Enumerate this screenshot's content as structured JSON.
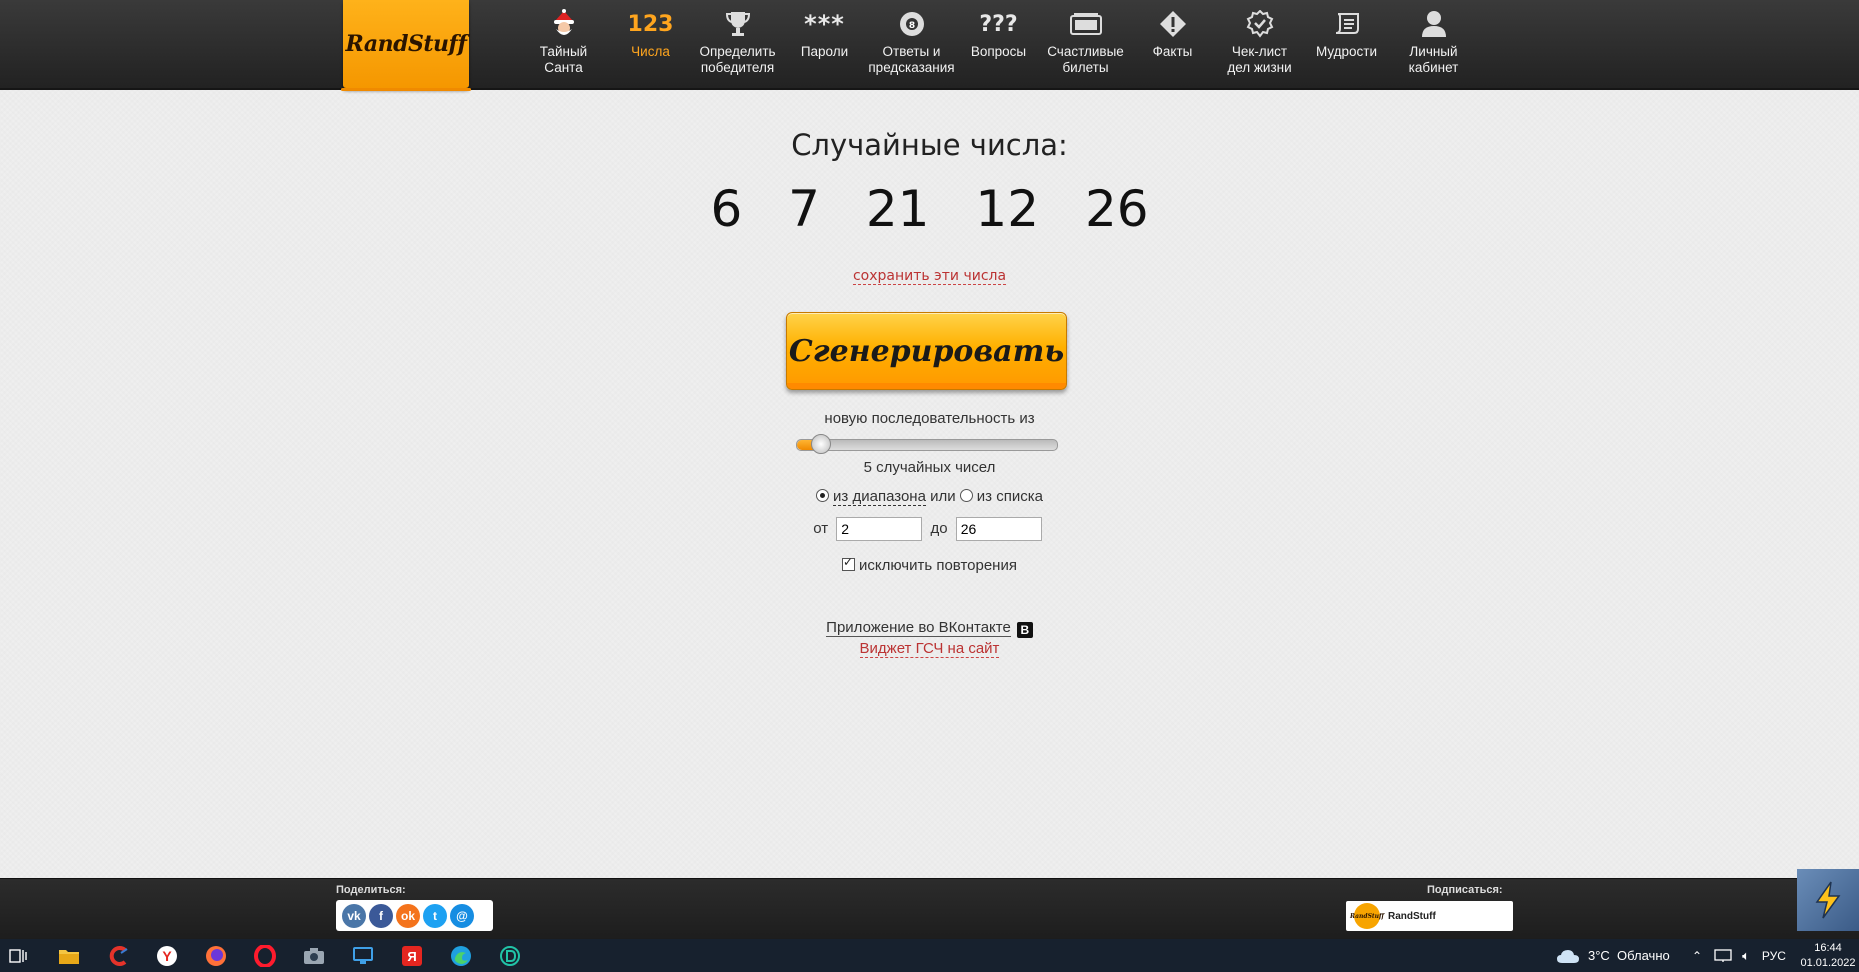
{
  "logo": {
    "text": "RandStuff"
  },
  "nav": {
    "items": [
      {
        "label": "Тайный\nСанта",
        "icon": "santa-icon"
      },
      {
        "label": "Числа",
        "icon": "numbers-icon",
        "icon_text": "123",
        "active": true
      },
      {
        "label": "Определить\nпобедителя",
        "icon": "trophy-icon"
      },
      {
        "label": "Пароли",
        "icon": "password-icon",
        "icon_text": "***"
      },
      {
        "label": "Ответы и\nпредсказания",
        "icon": "eight-ball-icon"
      },
      {
        "label": "Вопросы",
        "icon": "question-icon",
        "icon_text": "???"
      },
      {
        "label": "Счастливые\nбилеты",
        "icon": "ticket-icon"
      },
      {
        "label": "Факты",
        "icon": "fact-icon"
      },
      {
        "label": "Чек-лист\nдел жизни",
        "icon": "checklist-icon"
      },
      {
        "label": "Мудрости",
        "icon": "scroll-icon"
      },
      {
        "label": "Личный\nкабинет",
        "icon": "user-icon"
      }
    ]
  },
  "main": {
    "title": "Случайные числа:",
    "numbers": [
      "6",
      "7",
      "21",
      "12",
      "26"
    ],
    "save_link": "сохранить эти числа",
    "generate_label": "Сгенерировать",
    "sequence_label": "новую последовательность из",
    "count_value": 5,
    "count_label": "5 случайных чисел",
    "mode_range": "из диапазона",
    "mode_or": "или",
    "mode_list": "из списка",
    "from_label": "от",
    "from_value": "2",
    "to_label": "до",
    "to_value": "26",
    "exclude_repeats": "исключить повторения",
    "vk_app": "Приложение во ВКонтакте",
    "vk_badge": "B",
    "widget_link": "Виджет ГСЧ на сайт"
  },
  "footer": {
    "share_label": "Поделиться:",
    "social": [
      {
        "name": "vk",
        "glyph": "vk",
        "color": "#4a76a8"
      },
      {
        "name": "facebook",
        "glyph": "f",
        "color": "#3b5998"
      },
      {
        "name": "odnoklassniki",
        "glyph": "ok",
        "color": "#f4731c"
      },
      {
        "name": "twitter",
        "glyph": "t",
        "color": "#1da1f2"
      },
      {
        "name": "mail",
        "glyph": "@",
        "color": "#168de2"
      }
    ],
    "subscribe_label": "Подписаться:",
    "subscribe_name": "RandStuff"
  },
  "taskbar": {
    "weather": "3°C  Облачно",
    "lang": "РУС",
    "time": "16:44",
    "date": "01.01.2022"
  },
  "colors": {
    "accent": "#ffa51e",
    "link": "#b33333",
    "topbar": "#2a2a2a"
  }
}
